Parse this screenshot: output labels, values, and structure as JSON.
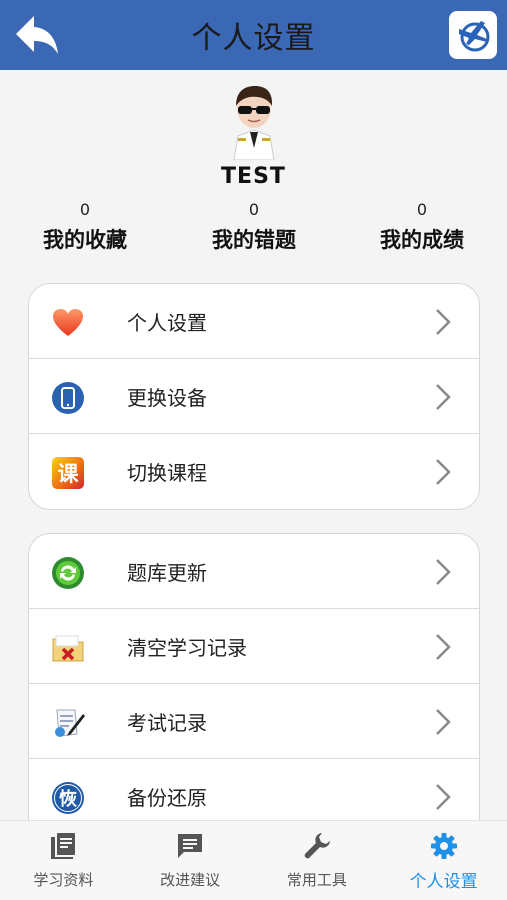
{
  "header": {
    "title": "个人设置"
  },
  "profile": {
    "username": "TEST"
  },
  "stats": [
    {
      "count": "0",
      "label": "我的收藏"
    },
    {
      "count": "0",
      "label": "我的错题"
    },
    {
      "count": "0",
      "label": "我的成绩"
    }
  ],
  "group1": [
    {
      "label": "个人设置",
      "icon": "heart-icon"
    },
    {
      "label": "更换设备",
      "icon": "phone-icon"
    },
    {
      "label": "切换课程",
      "icon": "course-icon",
      "icon_text": "课"
    }
  ],
  "group2": [
    {
      "label": "题库更新",
      "icon": "refresh-icon"
    },
    {
      "label": "清空学习记录",
      "icon": "clear-folder-icon"
    },
    {
      "label": "考试记录",
      "icon": "exam-record-icon"
    },
    {
      "label": "备份还原",
      "icon": "restore-icon",
      "icon_text": "恢"
    }
  ],
  "tabs": [
    {
      "label": "学习资料",
      "icon": "book-icon"
    },
    {
      "label": "改进建议",
      "icon": "chat-icon"
    },
    {
      "label": "常用工具",
      "icon": "wrench-icon"
    },
    {
      "label": "个人设置",
      "icon": "gear-icon"
    }
  ],
  "colors": {
    "header": "#3a68b4",
    "active_tab": "#1e90e8",
    "background": "#f4f4f4"
  }
}
